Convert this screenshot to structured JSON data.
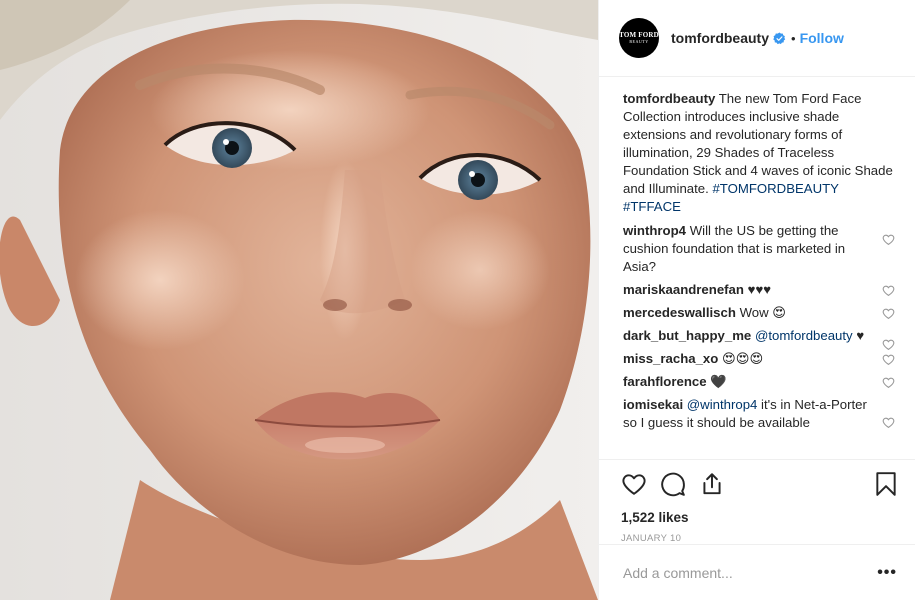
{
  "header": {
    "avatar_line1": "TOM FORD",
    "avatar_line2": "BEAUTY",
    "username": "tomfordbeauty",
    "separator": "•",
    "follow_label": "Follow",
    "verified_icon": "verified-badge-icon"
  },
  "caption": {
    "username": "tomfordbeauty",
    "text": "The new Tom Ford Face Collection introduces inclusive shade extensions and revolutionary forms of illumination, 29 Shades of Traceless Foundation Stick and 4 waves of iconic Shade and Illuminate.",
    "hashtag1": "#TOMFORDBEAUTY",
    "hashtag2": "#TFFACE"
  },
  "comments": [
    {
      "username": "winthrop4",
      "text": "Will the US be getting the cushion foundation that is marketed in Asia?"
    },
    {
      "username": "mariskaandrenefan",
      "text": "♥♥♥"
    },
    {
      "username": "mercedeswallisch",
      "text": "Wow 😍"
    },
    {
      "username": "dark_but_happy_me",
      "mention": "@tomfordbeauty",
      "text": "♥"
    },
    {
      "username": "miss_racha_xo",
      "text": "😍😍😍"
    },
    {
      "username": "farahflorence",
      "text": "🖤"
    },
    {
      "username": "iomisekai",
      "mention": "@winthrop4",
      "text": "it's in Net-a-Porter so I guess it should be available"
    }
  ],
  "actions": {
    "likes": "1,522 likes",
    "date": "JANUARY 10"
  },
  "add_comment": {
    "placeholder": "Add a comment...",
    "more_label": "•••"
  },
  "colors": {
    "link": "#3897f0",
    "hashtag": "#003569",
    "muted": "#999999",
    "border": "#efefef"
  }
}
